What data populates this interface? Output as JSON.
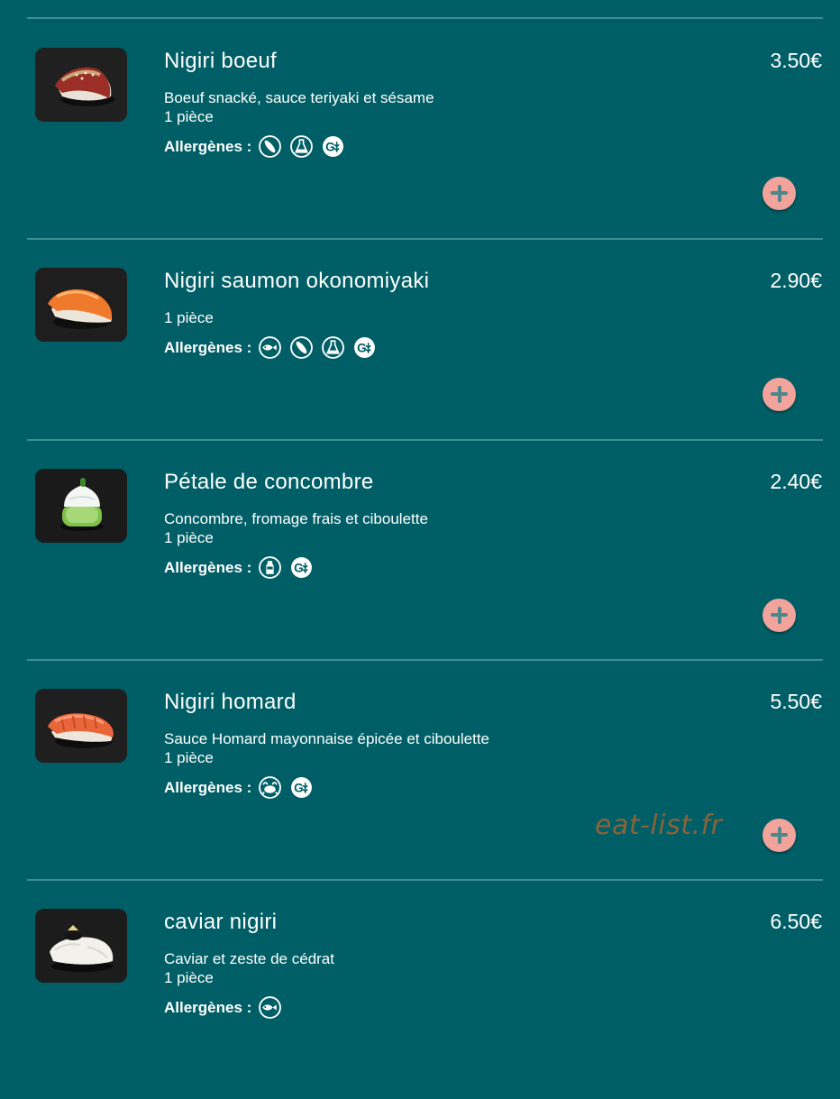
{
  "allergen_label": "Allergènes :",
  "items": [
    {
      "name": "Nigiri boeuf",
      "price": "3.50€",
      "desc1": "Boeuf snacké, sauce teriyaki et sésame",
      "desc2": "1 pièce",
      "allergens": [
        "sesame-icon",
        "sauce-bottle-icon",
        "gluten-icon"
      ],
      "photo": "beef-nigiri-photo"
    },
    {
      "name": "Nigiri saumon okonomiyaki",
      "price": "2.90€",
      "desc1": "1 pièce",
      "desc2": "",
      "allergens": [
        "fish-icon",
        "sesame-icon",
        "sauce-bottle-icon",
        "gluten-icon"
      ],
      "photo": "salmon-nigiri-photo"
    },
    {
      "name": "Pétale de concombre",
      "price": "2.40€",
      "desc1": "Concombre, fromage frais et ciboulette",
      "desc2": "1 pièce",
      "allergens": [
        "milk-icon",
        "gluten-icon"
      ],
      "photo": "cucumber-petal-photo"
    },
    {
      "name": "Nigiri homard",
      "price": "5.50€",
      "desc1": "Sauce Homard mayonnaise épicée et ciboulette",
      "desc2": "1 pièce",
      "allergens": [
        "crustacean-icon",
        "gluten-icon"
      ],
      "photo": "lobster-nigiri-photo"
    },
    {
      "name": "caviar nigiri",
      "price": "6.50€",
      "desc1": "Caviar et zeste de cédrat",
      "desc2": "1 pièce",
      "allergens": [
        "fish-icon"
      ],
      "photo": "caviar-nigiri-photo"
    }
  ],
  "watermark": "eat-list.fr",
  "colors": {
    "background": "#005f66",
    "divider": "#3f8e93",
    "add_button": "#f2a49c",
    "add_plus": "#4e878a",
    "watermark": "#8c6239"
  }
}
